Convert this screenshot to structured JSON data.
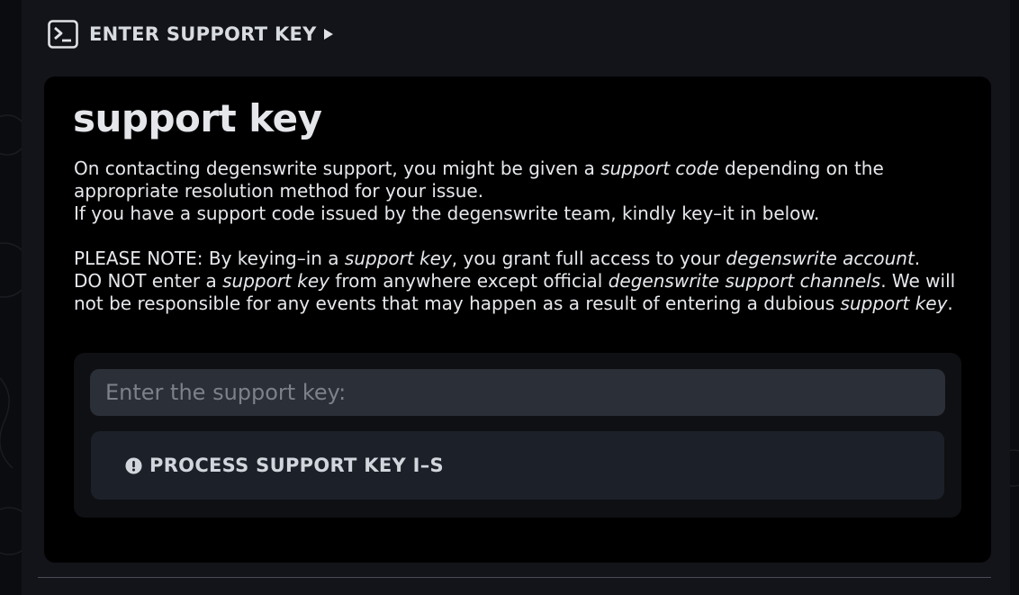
{
  "header": {
    "title": "ENTER SUPPORT KEY",
    "icon": "terminal-icon",
    "toggle_icon": "play-icon"
  },
  "card": {
    "title": "support key",
    "intro": {
      "t1": "On contacting degenswrite support, you might be given a ",
      "e1": "support code",
      "t2": " depending on the appropriate resolution method for your issue."
    },
    "instruction": "If you have a support code issued by the degenswrite team, kindly key–it in below.",
    "note": {
      "t1": "PLEASE NOTE: By keying–in a ",
      "e1": "support key",
      "t2": ", you grant full access to your ",
      "e2": "degenswrite account",
      "t3": ".",
      "t4": "DO NOT enter a ",
      "e3": "support key",
      "t5": " from anywhere except official ",
      "e4": "degenswrite support channels",
      "t6": ". We will not be responsible for any events that may happen as a result of entering a dubious ",
      "e5": "support key",
      "t7": "."
    }
  },
  "form": {
    "input_value": "",
    "input_placeholder": "Enter the support key:",
    "button_label": "PROCESS SUPPORT KEY I–S",
    "button_icon": "alert-circle-icon"
  },
  "colors": {
    "page_bg": "#0b0c0f",
    "panel_bg": "#121419",
    "card_bg": "#000000",
    "input_bg": "#2b2f38",
    "button_bg": "#1c2028",
    "text": "#e6e8ec"
  }
}
